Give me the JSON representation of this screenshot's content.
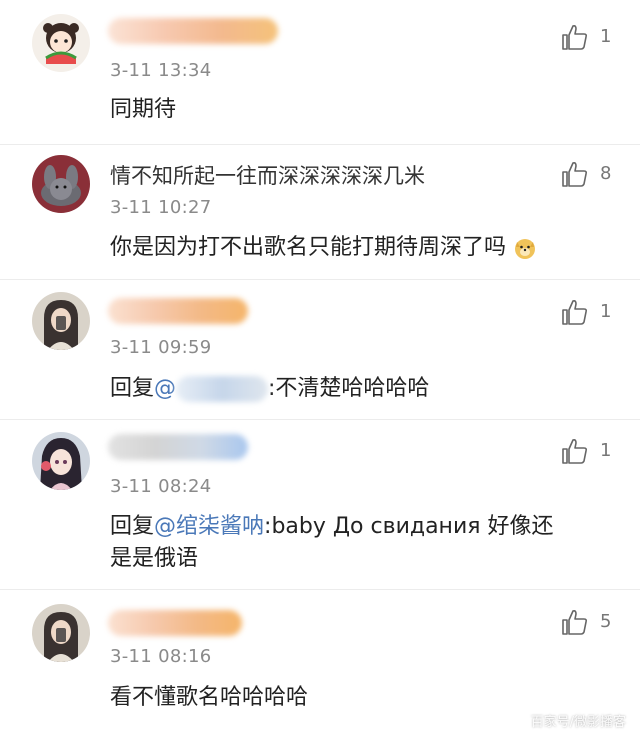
{
  "comments": [
    {
      "username": "",
      "time": "3-11 13:34",
      "text": "同期待",
      "likes": "1",
      "avatar_icon": "cartoon-girl-watermelon-avatar"
    },
    {
      "username": "情不知所起一往而深深深深深几米",
      "time": "3-11 10:27",
      "text": "你是因为打不出歌名只能打期待周深了吗",
      "likes": "8",
      "avatar_icon": "bunny-photo-avatar"
    },
    {
      "username": "",
      "time": "3-11 09:59",
      "reply_prefix": "回复",
      "mention": "@",
      "text": ":不清楚哈哈哈哈",
      "likes": "1",
      "avatar_icon": "girl-selfie-avatar"
    },
    {
      "username": "",
      "time": "3-11 08:24",
      "reply_prefix": "回复",
      "mention": "@绾柒酱呐",
      "text_line1": ":baby До свидания 好像还",
      "text_line2": "是是俄语",
      "likes": "1",
      "avatar_icon": "anime-girl-avatar"
    },
    {
      "username": "",
      "time": "3-11 08:16",
      "text": "看不懂歌名哈哈哈哈",
      "likes": "5",
      "avatar_icon": "girl-selfie-avatar"
    }
  ],
  "watermark": "百家号/微影播客",
  "colors": {
    "mention": "#4a78b8",
    "time": "#8a8a8a",
    "divider": "#ececec"
  }
}
